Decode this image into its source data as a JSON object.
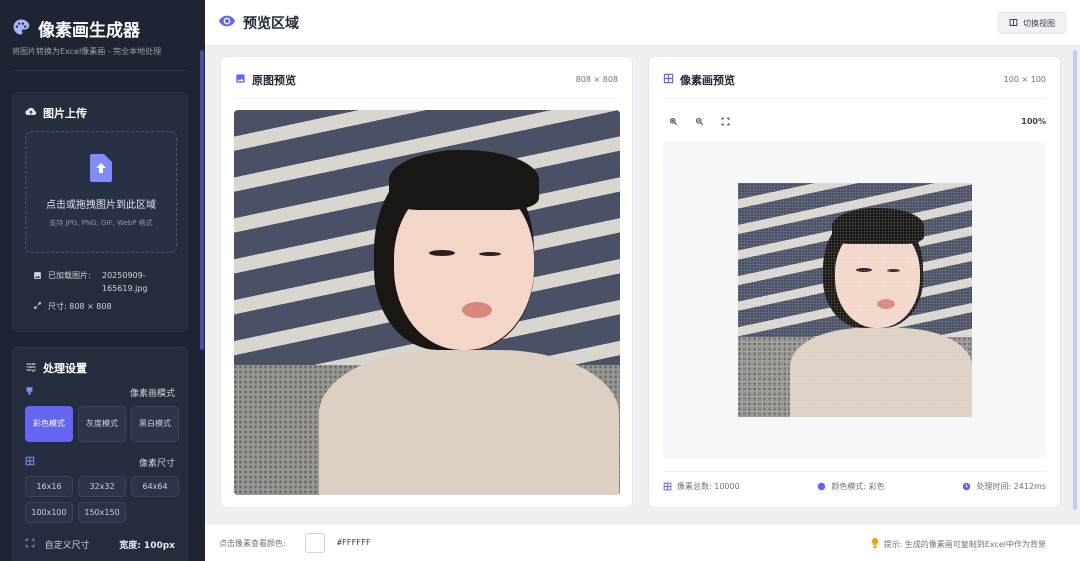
{
  "app": {
    "title": "像素画生成器",
    "subtitle": "将图片转换为Excel像素画 - 完全本地处理"
  },
  "upload": {
    "title": "图片上传",
    "drop_main": "点击或拖拽图片到此区域",
    "drop_sub": "支持 JPG, PNG, GIF, WebP 格式",
    "loaded_label": "已加载图片:",
    "loaded_name": "20250909-165619.jpg",
    "size_text": "尺寸: 808 × 808"
  },
  "settings": {
    "title": "处理设置",
    "mode_label": "像素画模式",
    "modes": [
      "彩色模式",
      "灰度模式",
      "黑白模式"
    ],
    "active_mode": "彩色模式",
    "size_label": "像素尺寸",
    "sizes": [
      "16x16",
      "32x32",
      "64x64",
      "100x100",
      "150x150"
    ],
    "selected_size": "100x100",
    "custom_label": "自定义尺寸",
    "width_text": "宽度: 100px"
  },
  "topbar": {
    "title": "预览区域",
    "switch_label": "切换视图"
  },
  "original": {
    "title": "原图预览",
    "dims": "808 × 808"
  },
  "pixel": {
    "title": "像素画预览",
    "dims": "100 × 100",
    "zoom": "100%",
    "stat_total": "像素总数: 10000",
    "stat_mode": "颜色模式: 彩色",
    "stat_time": "处理时间: 2412ms"
  },
  "footer": {
    "color_label": "点击像素查看颜色:",
    "color_hex": "#FFFFFF",
    "hint": "提示: 生成的像素画可复制到Excel中作为背景"
  },
  "colors": {
    "accent": "#6366f1",
    "sidebar": "#1e2433"
  }
}
